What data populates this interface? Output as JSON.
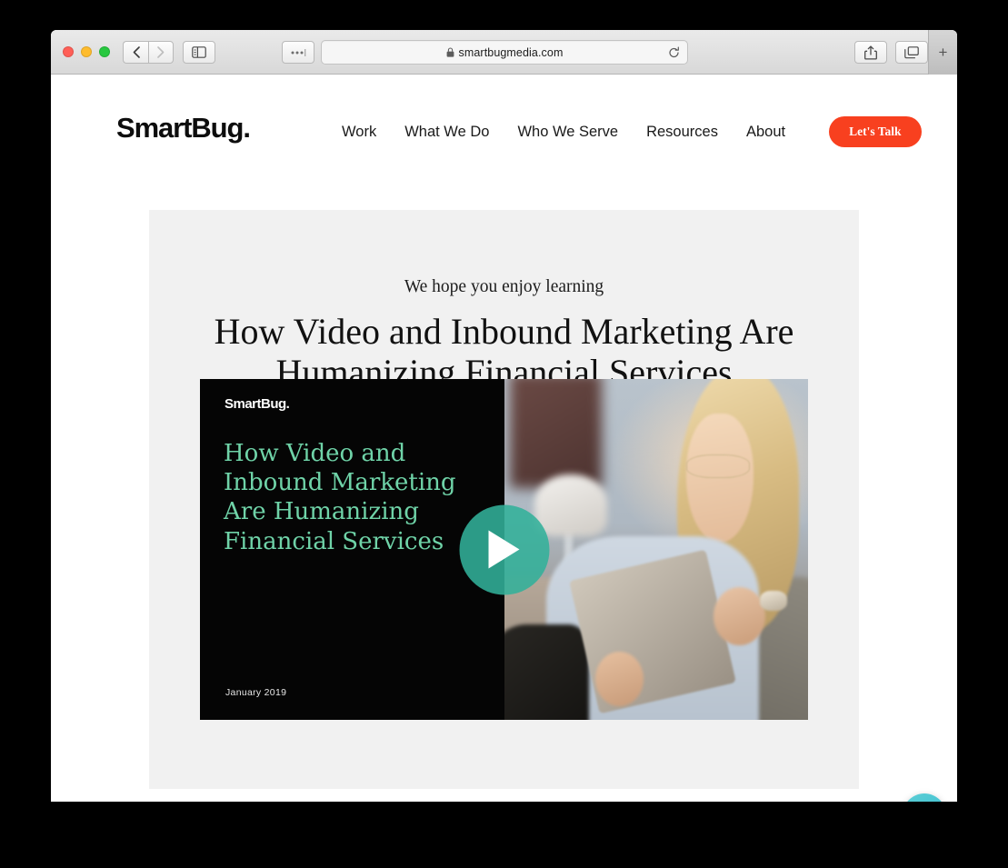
{
  "browser": {
    "url": "smartbugmedia.com",
    "secure_icon": "lock-icon",
    "back_icon": "chevron-left-icon",
    "forward_icon": "chevron-right-icon",
    "sidebar_icon": "sidebar-toggle-icon",
    "overflow_icon": "ellipsis-icon",
    "reload_icon": "reload-icon",
    "share_icon": "share-icon",
    "tabs_icon": "tab-overview-icon",
    "newtab_label": "+",
    "traffic_lights": {
      "close": "#ff5f57",
      "minimize": "#febc2e",
      "maximize": "#28c840"
    }
  },
  "site": {
    "brand": "SmartBug.",
    "nav": [
      {
        "label": "Work"
      },
      {
        "label": "What We Do"
      },
      {
        "label": "Who We Serve"
      },
      {
        "label": "Resources"
      },
      {
        "label": "About"
      }
    ],
    "cta": {
      "label": "Let's Talk",
      "color": "#f8401f"
    }
  },
  "content": {
    "eyebrow": "We hope you enjoy learning",
    "headline": "How Video and Inbound Marketing Are Humanizing Financial Services",
    "card_background": "#f1f1f1"
  },
  "video": {
    "brand": "SmartBug.",
    "title": "How Video and Inbound Marketing Are Humanizing Financial Services",
    "date": "January 2019",
    "title_color": "#6fd3a8",
    "play_icon": "play-icon",
    "play_color": "#32b09a",
    "photo_alt": "woman with glasses smiling at a tablet on a couch"
  },
  "chat": {
    "icon": "chat-bubbles-icon",
    "color": "#2fb9cf"
  }
}
